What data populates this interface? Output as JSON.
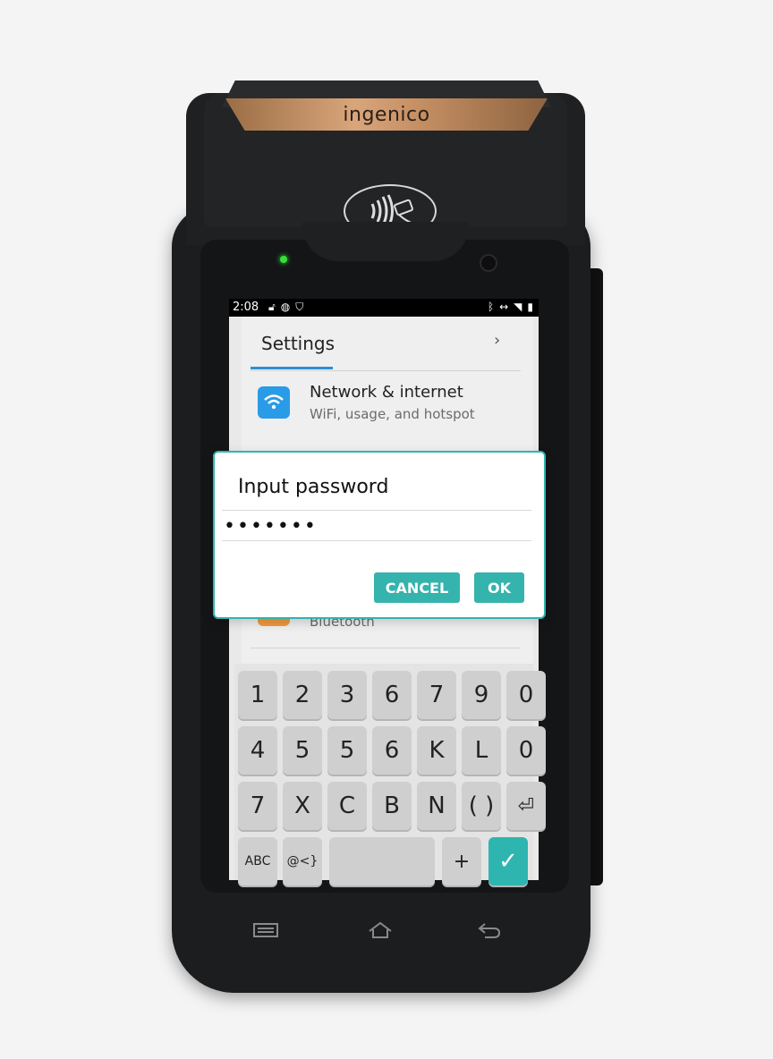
{
  "device": {
    "brand": "ingenico"
  },
  "status_bar": {
    "time": "2:08",
    "left_icons": [
      "lock-icon",
      "globe-icon",
      "shield-icon"
    ],
    "right_icons": [
      "bluetooth-icon",
      "data-arrows-icon",
      "signal-icon",
      "battery-icon"
    ]
  },
  "settings": {
    "title": "Settings",
    "items": [
      {
        "icon": "wifi-icon",
        "title": "Network & internet",
        "subtitle": "WiFi, usage, and hotspot"
      },
      {
        "icon": "bluetooth-icon",
        "title": "",
        "subtitle": "Bluetooth"
      }
    ]
  },
  "dialog": {
    "title": "Input password",
    "value": "•••••••",
    "cancel_label": "CANCEL",
    "ok_label": "OK"
  },
  "keyboard": {
    "rows": [
      [
        "1",
        "2",
        "3",
        "6",
        "7",
        "9",
        "0"
      ],
      [
        "4",
        "5",
        "5",
        "6",
        "K",
        "L",
        "0"
      ],
      [
        "7",
        "X",
        "C",
        "B",
        "N",
        "( )",
        "⏎"
      ],
      [
        "ABC",
        "@<}",
        "",
        "+",
        "✓"
      ]
    ]
  },
  "nav_bar": {
    "items": [
      "menu-icon",
      "home-icon",
      "back-icon"
    ]
  },
  "colors": {
    "accent": "#35b3ad",
    "wifi_tile": "#2a9be6",
    "bt_tile": "#f39a3c",
    "brand_band": "#c58f63"
  }
}
